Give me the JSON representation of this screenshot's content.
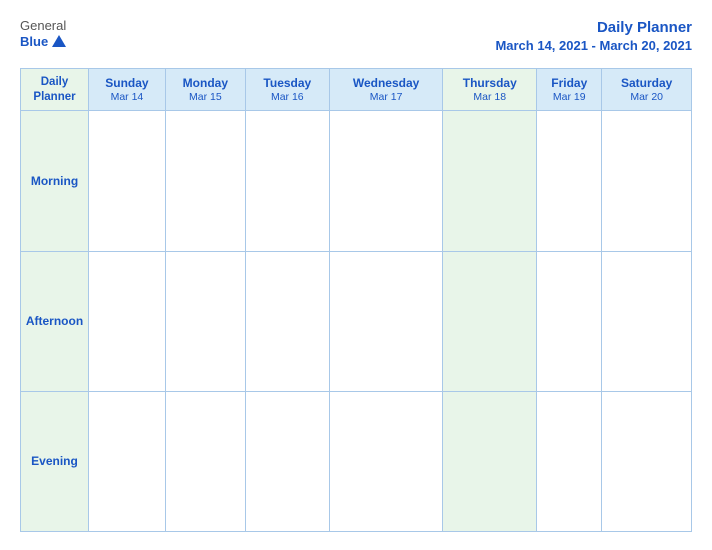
{
  "logo": {
    "general": "General",
    "blue": "Blue",
    "triangle": true
  },
  "title": {
    "main": "Daily Planner",
    "date_range": "March 14, 2021 - March 20, 2021"
  },
  "header_row": {
    "label_col": {
      "line1": "Daily",
      "line2": "Planner"
    },
    "days": [
      {
        "name": "Sunday",
        "date": "Mar 14"
      },
      {
        "name": "Monday",
        "date": "Mar 15"
      },
      {
        "name": "Tuesday",
        "date": "Mar 16"
      },
      {
        "name": "Wednesday",
        "date": "Mar 17"
      },
      {
        "name": "Thursday",
        "date": "Mar 18"
      },
      {
        "name": "Friday",
        "date": "Mar 19"
      },
      {
        "name": "Saturday",
        "date": "Mar 20"
      }
    ]
  },
  "rows": [
    {
      "label": "Morning"
    },
    {
      "label": "Afternoon"
    },
    {
      "label": "Evening"
    }
  ]
}
